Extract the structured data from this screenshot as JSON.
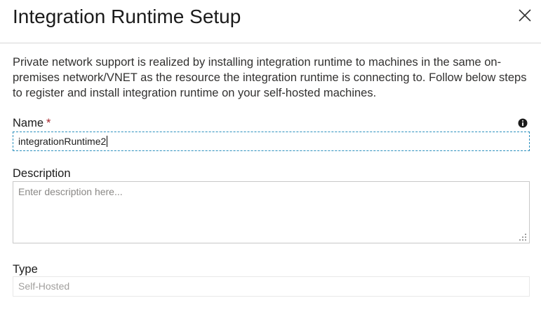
{
  "dialog": {
    "title": "Integration Runtime Setup",
    "close_icon": "close-icon"
  },
  "description_text": "Private network support is realized by installing integration runtime to machines in the same on-premises network/VNET as the resource the integration runtime is connecting to. Follow below steps to register and install integration runtime on your self-hosted machines.",
  "form": {
    "name": {
      "label": "Name",
      "required_marker": "*",
      "value": "integrationRuntime2",
      "info_icon": "info-icon"
    },
    "description": {
      "label": "Description",
      "value": "",
      "placeholder": "Enter description here..."
    },
    "type": {
      "label": "Type",
      "value": "Self-Hosted"
    }
  },
  "colors": {
    "required": "#a4262c",
    "focus_border": "#2a8fbd",
    "disabled_text": "#a19f9d"
  }
}
